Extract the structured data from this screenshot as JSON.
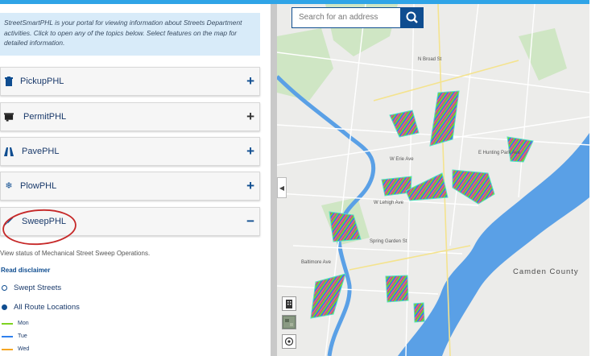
{
  "intro": {
    "lines": [
      "StreetSmartPHL is your portal for viewing information about Streets Department",
      "activities. Click to open any of the topics below. Select features on the map for",
      "detailed information."
    ]
  },
  "accordion": [
    {
      "label": "PickupPHL",
      "icon": "trash-icon",
      "toggle": "+"
    },
    {
      "label": "PermitPHL",
      "icon": "permit-icon",
      "toggle": "+"
    },
    {
      "label": "PavePHL",
      "icon": "road-icon",
      "toggle": "+"
    },
    {
      "label": "PlowPHL",
      "icon": "snowflake-icon",
      "toggle": "+"
    },
    {
      "label": "SweepPHL",
      "icon": "broom-icon",
      "toggle": "−"
    }
  ],
  "sweep": {
    "description": "View status of Mechanical Street Sweep Operations.",
    "disclaimer": "Read disclaimer",
    "options": [
      "Swept Streets",
      "All Route Locations"
    ],
    "legend": [
      {
        "label": "Mon",
        "color": "#7ed321"
      },
      {
        "label": "Tue",
        "color": "#2f80ed"
      },
      {
        "label": "Wed",
        "color": "#f5a623"
      }
    ]
  },
  "search": {
    "placeholder": "Search for an address"
  },
  "map": {
    "labels": {
      "camden": "Camden County",
      "street1": "W Erie Ave",
      "street2": "E Hunting Park Ave",
      "street3": "W Lehigh Ave",
      "street4": "Spring Garden St",
      "street5": "Baltimore Ave",
      "street6": "N Broad St"
    },
    "colors": {
      "water": "#5aa0e6",
      "park": "#cfe6c4",
      "route_mix": [
        "#7ed321",
        "#2f80ed",
        "#f5a623",
        "#d0021b",
        "#bd10e0",
        "#50e3c2"
      ]
    }
  }
}
